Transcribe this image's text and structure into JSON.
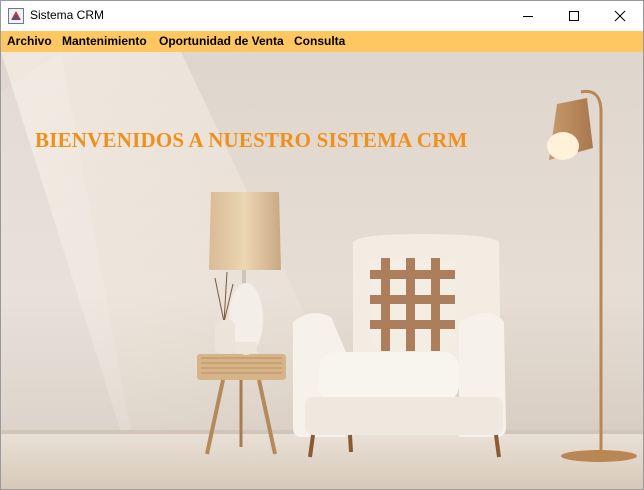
{
  "window": {
    "title": "Sistema CRM",
    "controls": [
      "minimize",
      "maximize",
      "close"
    ]
  },
  "menu": {
    "items": [
      {
        "label": "Archivo"
      },
      {
        "label": "Mantenimiento"
      },
      {
        "label": "Oportunidad de Venta"
      },
      {
        "label": "Consulta"
      }
    ]
  },
  "content": {
    "welcome_text": "BIENVENIDOS A NUESTRO SISTEMA CRM",
    "background_image": "living room with armchair, side table and lamps"
  },
  "colors": {
    "menu_bar": "#ffc762",
    "welcome_text": "#f0901c"
  }
}
